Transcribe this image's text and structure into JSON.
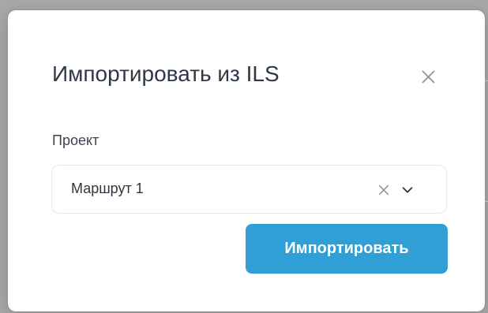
{
  "dialog": {
    "title": "Импортировать из ILS",
    "project": {
      "label": "Проект",
      "selected": "Маршрут 1"
    },
    "submit_label": "Импортировать"
  },
  "icons": {
    "close": "close-icon",
    "clear": "clear-selection-icon",
    "dropdown": "chevron-down-icon"
  },
  "colors": {
    "primary_button": "#2f9fd6",
    "title_text": "#2f3846",
    "muted_icon": "#8f96a3",
    "input_border": "#e4e7ec",
    "backdrop": "#a7a7a7"
  }
}
